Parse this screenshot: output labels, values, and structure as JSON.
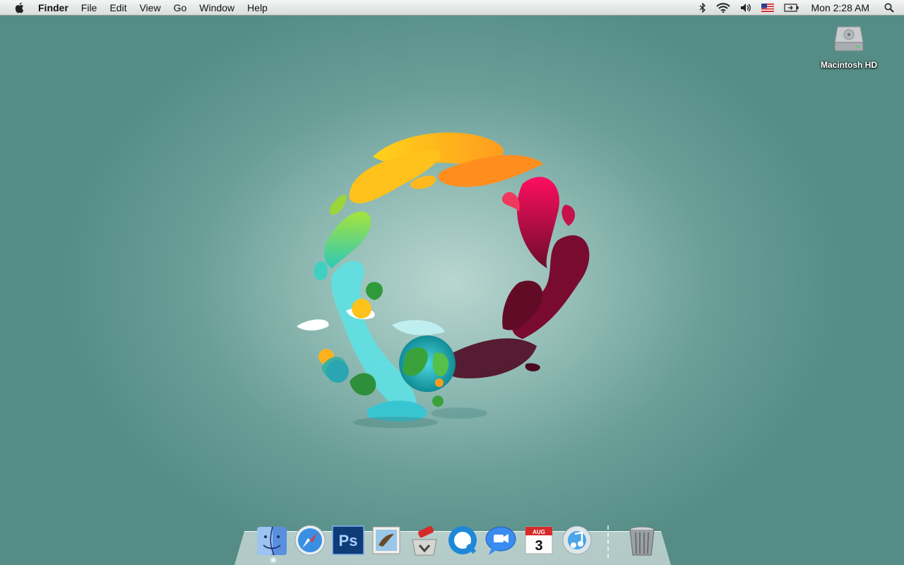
{
  "menubar": {
    "apple_icon": "apple-logo-icon",
    "app_name": "Finder",
    "items": [
      "File",
      "Edit",
      "View",
      "Go",
      "Window",
      "Help"
    ],
    "status_icons": [
      "bluetooth-icon",
      "wifi-icon",
      "volume-icon",
      "us-flag-input-icon",
      "battery-icon"
    ],
    "clock": "Mon 2:28 AM",
    "spotlight_icon": "spotlight-search-icon"
  },
  "desktop": {
    "drive_label": "Macintosh HD"
  },
  "dock": {
    "apps": [
      {
        "name": "Finder",
        "icon": "finder-icon"
      },
      {
        "name": "Safari",
        "icon": "safari-icon"
      },
      {
        "name": "Photoshop",
        "icon": "photoshop-icon",
        "label": "Ps"
      },
      {
        "name": "Mail",
        "icon": "mail-icon"
      },
      {
        "name": "Transmit",
        "icon": "transmit-icon"
      },
      {
        "name": "QuickTime",
        "icon": "quicktime-icon"
      },
      {
        "name": "iChat",
        "icon": "ichat-icon"
      },
      {
        "name": "iCal",
        "icon": "ical-icon",
        "month": "AUG",
        "day": "3"
      },
      {
        "name": "iTunes",
        "icon": "itunes-icon"
      }
    ],
    "trash_icon": "trash-icon"
  },
  "colors": {
    "accent_orange": "#f7a21a",
    "accent_magenta": "#e0175f",
    "accent_green": "#8ed63a",
    "accent_cyan": "#36c8d3"
  }
}
